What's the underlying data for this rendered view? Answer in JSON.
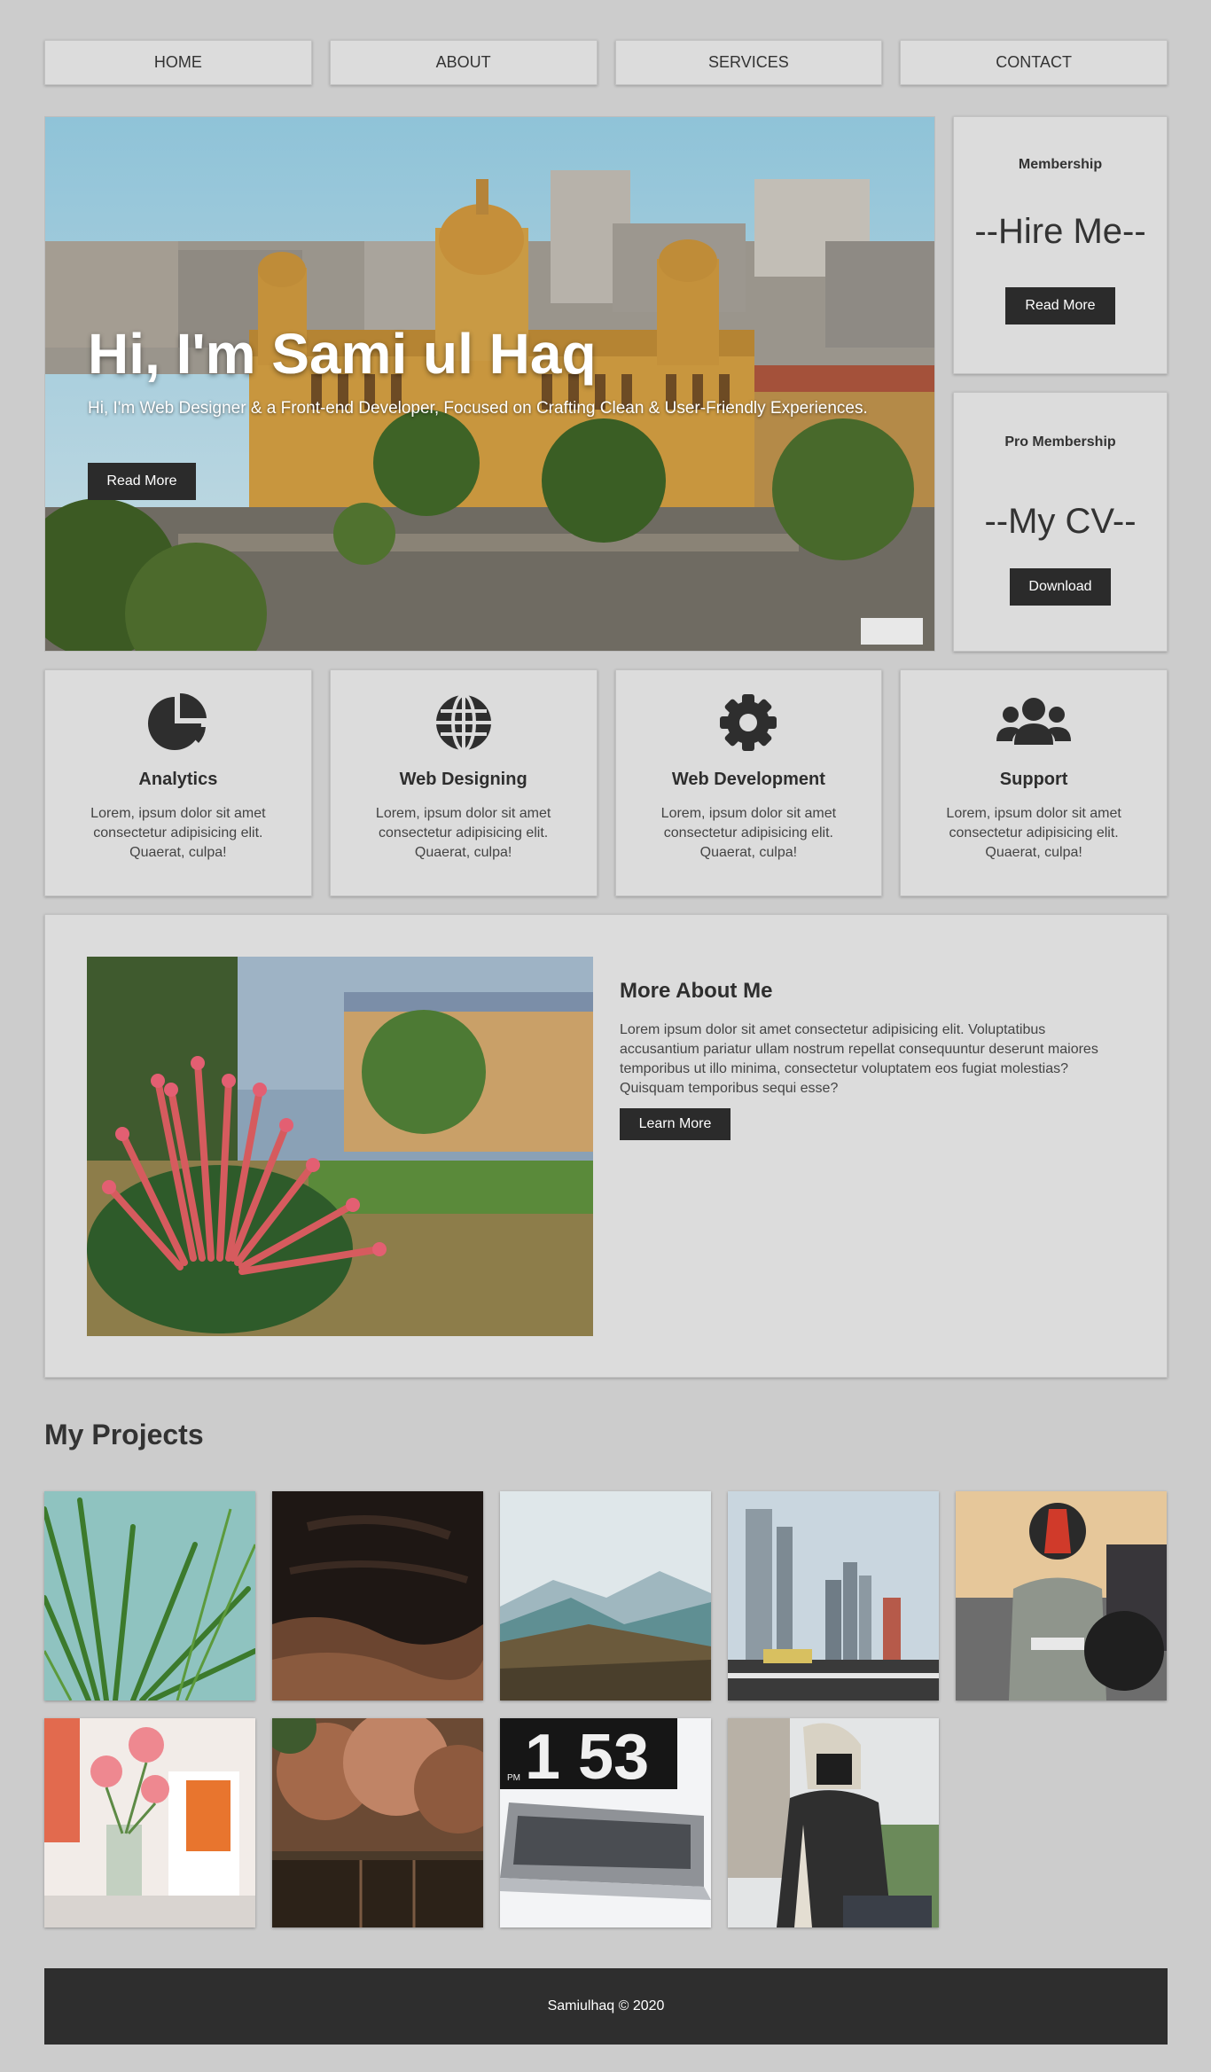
{
  "nav": {
    "items": [
      {
        "label": "HOME"
      },
      {
        "label": "ABOUT"
      },
      {
        "label": "SERVICES"
      },
      {
        "label": "CONTACT"
      }
    ]
  },
  "hero": {
    "title": "Hi, I'm Sami ul Haq",
    "subtitle": "Hi, I'm Web Designer & a Front-end Developer, Focused on Crafting Clean & User-Friendly Experiences.",
    "button_label": "Read More"
  },
  "side_cards": [
    {
      "label": "Membership",
      "headline": "--Hire Me--",
      "button_label": "Read More"
    },
    {
      "label": "Pro Membership",
      "headline": "--My CV--",
      "button_label": "Download"
    }
  ],
  "services": [
    {
      "icon": "chart-pie-icon",
      "title": "Analytics",
      "text": "Lorem, ipsum dolor sit amet consectetur adipisicing elit. Quaerat, culpa!"
    },
    {
      "icon": "globe-icon",
      "title": "Web Designing",
      "text": "Lorem, ipsum dolor sit amet consectetur adipisicing elit. Quaerat, culpa!"
    },
    {
      "icon": "gear-icon",
      "title": "Web Development",
      "text": "Lorem, ipsum dolor sit amet consectetur adipisicing elit. Quaerat, culpa!"
    },
    {
      "icon": "users-icon",
      "title": "Support",
      "text": "Lorem, ipsum dolor sit amet consectetur adipisicing elit. Quaerat, culpa!"
    }
  ],
  "about": {
    "title": "More About Me",
    "text": "Lorem ipsum dolor sit amet consectetur adipisicing elit. Voluptatibus accusantium pariatur ullam nostrum repellat consequuntur deserunt maiores temporibus ut illo minima, consectetur voluptatem eos fugiat molestias? Quisquam temporibus sequi esse?",
    "button_label": "Learn More"
  },
  "projects": {
    "title": "My Projects",
    "items": [
      {
        "subject": "palm-leaves"
      },
      {
        "subject": "desert-canyon"
      },
      {
        "subject": "mountain-valley"
      },
      {
        "subject": "city-skyline"
      },
      {
        "subject": "motorcyclist"
      },
      {
        "subject": "flower-vase"
      },
      {
        "subject": "autumn-forest"
      },
      {
        "subject": "laptop-clock"
      },
      {
        "subject": "hooded-person"
      }
    ]
  },
  "clock_digits": "1 53",
  "clock_pm": "PM",
  "footer": {
    "text": "Samiulhaq © 2020"
  },
  "colors": {
    "background": "#cccccc",
    "card": "#dcdcdc",
    "button": "#2b2b2b",
    "footer": "#2e2e2e"
  }
}
